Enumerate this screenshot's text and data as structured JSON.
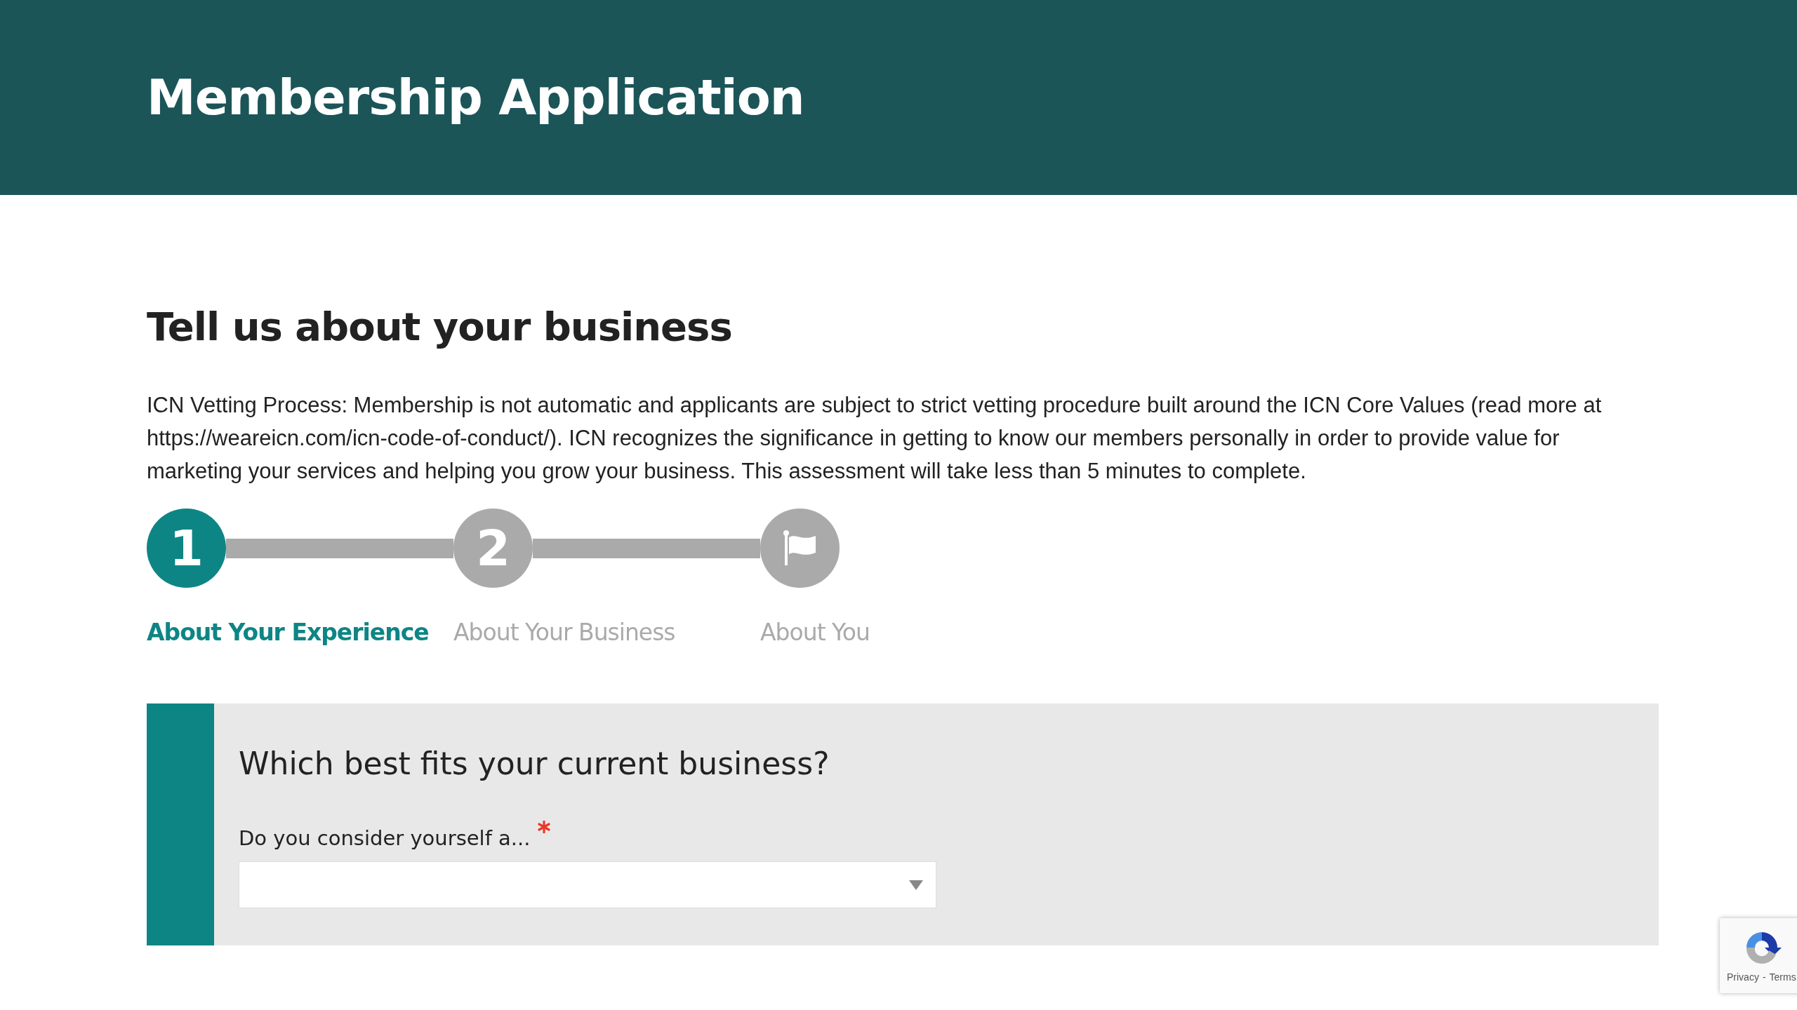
{
  "header": {
    "title": "Membership Application"
  },
  "section": {
    "heading": "Tell us about your business",
    "intro": "ICN Vetting Process: Membership is not automatic and applicants are subject to strict vetting procedure built around the ICN Core Values (read more at https://weareicn.com/icn-code-of-conduct/). ICN recognizes the significance in getting to know our members personally in order to provide value for marketing your services and helping you grow your business. This assessment will take less than 5 minutes to complete."
  },
  "steps": [
    {
      "kind": "number",
      "number": "1",
      "label": "About Your Experience",
      "selected": true
    },
    {
      "kind": "number",
      "number": "2",
      "label": "About Your Business",
      "selected": false
    },
    {
      "kind": "flag",
      "label": "About You",
      "selected": false
    }
  ],
  "question": {
    "title": "Which best fits your current business?",
    "field_label": "Do you consider yourself a...",
    "required": true
  },
  "recaptcha": {
    "links": [
      "Privacy",
      "Terms"
    ],
    "separator": "-"
  }
}
